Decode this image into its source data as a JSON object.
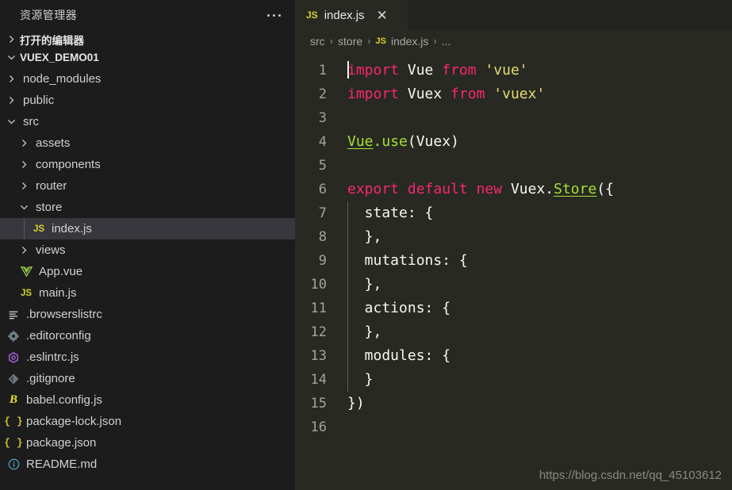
{
  "sidebar": {
    "header_title": "资源管理器",
    "more_icon": "ellipsis-icon",
    "open_editors": {
      "label": "打开的编辑器",
      "expanded": false
    },
    "project": {
      "label": "VUEX_DEMO01",
      "expanded": true
    },
    "tree": [
      {
        "label": "node_modules",
        "type": "folder",
        "expanded": false,
        "depth": 1
      },
      {
        "label": "public",
        "type": "folder",
        "expanded": false,
        "depth": 1
      },
      {
        "label": "src",
        "type": "folder",
        "expanded": true,
        "depth": 1
      },
      {
        "label": "assets",
        "type": "folder",
        "expanded": false,
        "depth": 2
      },
      {
        "label": "components",
        "type": "folder",
        "expanded": false,
        "depth": 2
      },
      {
        "label": "router",
        "type": "folder",
        "expanded": false,
        "depth": 2
      },
      {
        "label": "store",
        "type": "folder",
        "expanded": true,
        "depth": 2
      },
      {
        "label": "index.js",
        "type": "file",
        "icon": "js-file-icon",
        "depth": 3,
        "selected": true
      },
      {
        "label": "views",
        "type": "folder",
        "expanded": false,
        "depth": 2
      },
      {
        "label": "App.vue",
        "type": "file",
        "icon": "vue-file-icon",
        "depth": 2
      },
      {
        "label": "main.js",
        "type": "file",
        "icon": "js-file-icon",
        "depth": 2
      },
      {
        "label": ".browserslistrc",
        "type": "file",
        "icon": "list-file-icon",
        "depth": 1
      },
      {
        "label": ".editorconfig",
        "type": "file",
        "icon": "gear-file-icon",
        "depth": 1
      },
      {
        "label": ".eslintrc.js",
        "type": "file",
        "icon": "eslint-file-icon",
        "depth": 1
      },
      {
        "label": ".gitignore",
        "type": "file",
        "icon": "git-file-icon",
        "depth": 1
      },
      {
        "label": "babel.config.js",
        "type": "file",
        "icon": "babel-file-icon",
        "depth": 1
      },
      {
        "label": "package-lock.json",
        "type": "file",
        "icon": "json-file-icon",
        "depth": 1
      },
      {
        "label": "package.json",
        "type": "file",
        "icon": "json-file-icon",
        "depth": 1
      },
      {
        "label": "README.md",
        "type": "file",
        "icon": "info-file-icon",
        "depth": 1
      }
    ]
  },
  "editor": {
    "tab": {
      "name": "index.js",
      "icon": "js-file-icon",
      "close_label": "✕"
    },
    "breadcrumb": [
      {
        "label": "src",
        "icon": null
      },
      {
        "label": "store",
        "icon": null
      },
      {
        "label": "index.js",
        "icon": "js-file-icon"
      },
      {
        "label": "...",
        "icon": null
      }
    ],
    "breadcrumb_separator": "›",
    "line_numbers": [
      "1",
      "2",
      "3",
      "4",
      "5",
      "6",
      "7",
      "8",
      "9",
      "10",
      "11",
      "12",
      "13",
      "14",
      "15",
      "16"
    ],
    "code_lines": [
      {
        "n": "1",
        "tokens": [
          {
            "t": "import",
            "c": "kw"
          },
          {
            "t": " ",
            "c": "plain"
          },
          {
            "t": "Vue",
            "c": "plain"
          },
          {
            "t": " ",
            "c": "plain"
          },
          {
            "t": "from",
            "c": "kw"
          },
          {
            "t": " ",
            "c": "plain"
          },
          {
            "t": "'vue'",
            "c": "str"
          }
        ],
        "cursor": true
      },
      {
        "n": "2",
        "tokens": [
          {
            "t": "import",
            "c": "kw"
          },
          {
            "t": " ",
            "c": "plain"
          },
          {
            "t": "Vuex",
            "c": "plain"
          },
          {
            "t": " ",
            "c": "plain"
          },
          {
            "t": "from",
            "c": "kw"
          },
          {
            "t": " ",
            "c": "plain"
          },
          {
            "t": "'vuex'",
            "c": "str"
          }
        ]
      },
      {
        "n": "3",
        "tokens": []
      },
      {
        "n": "4",
        "tokens": [
          {
            "t": "Vue",
            "c": "link"
          },
          {
            "t": ".",
            "c": "fn"
          },
          {
            "t": "use",
            "c": "fn"
          },
          {
            "t": "(",
            "c": "punct"
          },
          {
            "t": "Vuex",
            "c": "plain"
          },
          {
            "t": ")",
            "c": "punct"
          }
        ]
      },
      {
        "n": "5",
        "tokens": []
      },
      {
        "n": "6",
        "tokens": [
          {
            "t": "export",
            "c": "kw"
          },
          {
            "t": " ",
            "c": "plain"
          },
          {
            "t": "default",
            "c": "kw"
          },
          {
            "t": " ",
            "c": "plain"
          },
          {
            "t": "new",
            "c": "kw"
          },
          {
            "t": " ",
            "c": "plain"
          },
          {
            "t": "Vuex.",
            "c": "plain"
          },
          {
            "t": "Store",
            "c": "link"
          },
          {
            "t": "({",
            "c": "punct"
          }
        ]
      },
      {
        "n": "7",
        "tokens": [
          {
            "t": "  state: {",
            "c": "plain"
          }
        ],
        "guide": true
      },
      {
        "n": "8",
        "tokens": [
          {
            "t": "  },",
            "c": "plain"
          }
        ],
        "guide": true
      },
      {
        "n": "9",
        "tokens": [
          {
            "t": "  mutations: {",
            "c": "plain"
          }
        ],
        "guide": true
      },
      {
        "n": "10",
        "tokens": [
          {
            "t": "  },",
            "c": "plain"
          }
        ],
        "guide": true
      },
      {
        "n": "11",
        "tokens": [
          {
            "t": "  actions: {",
            "c": "plain"
          }
        ],
        "guide": true
      },
      {
        "n": "12",
        "tokens": [
          {
            "t": "  },",
            "c": "plain"
          }
        ],
        "guide": true
      },
      {
        "n": "13",
        "tokens": [
          {
            "t": "  modules: {",
            "c": "plain"
          }
        ],
        "guide": true
      },
      {
        "n": "14",
        "tokens": [
          {
            "t": "  }",
            "c": "plain"
          }
        ],
        "guide": true
      },
      {
        "n": "15",
        "tokens": [
          {
            "t": "})",
            "c": "punct"
          }
        ]
      },
      {
        "n": "16",
        "tokens": []
      }
    ]
  },
  "watermark": "https://blog.csdn.net/qq_45103612",
  "colors": {
    "sidebar_bg": "#1c1c1c",
    "editor_bg": "#282923",
    "tabbar_bg": "#232420",
    "selected_row_bg": "#37373d",
    "keyword": "#f92672",
    "string": "#e6db74",
    "function": "#a6e22e",
    "text": "#f8f8f2",
    "line_number": "#a3a39b"
  }
}
